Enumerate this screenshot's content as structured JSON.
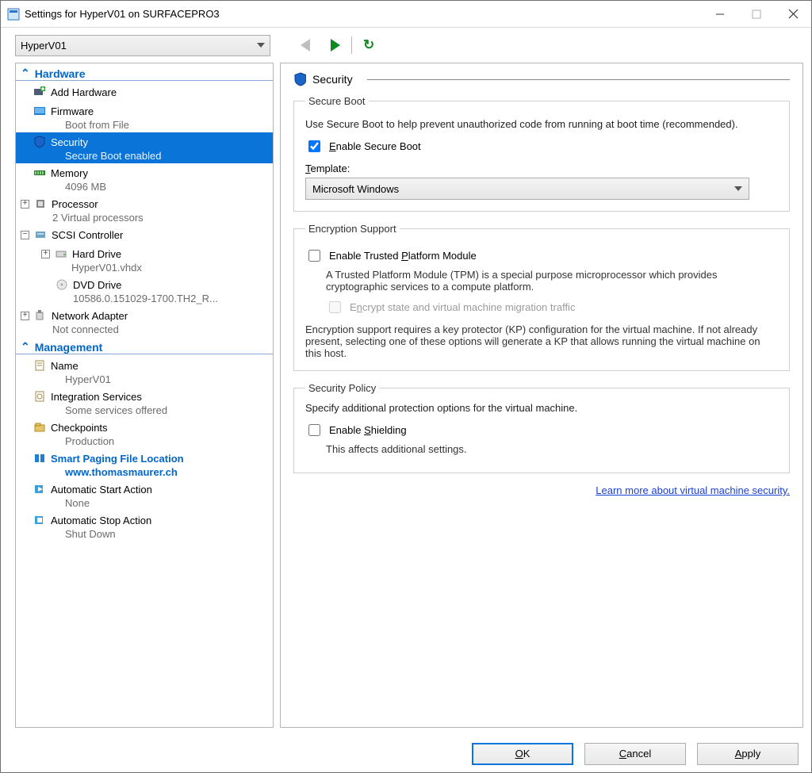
{
  "window": {
    "title": "Settings for HyperV01 on SURFACEPRO3"
  },
  "toolbar": {
    "vm_name": "HyperV01"
  },
  "tree": {
    "hardware_hdr": "Hardware",
    "management_hdr": "Management",
    "add_hw": "Add Hardware",
    "firmware": {
      "label": "Firmware",
      "sub": "Boot from File"
    },
    "security": {
      "label": "Security",
      "sub": "Secure Boot enabled"
    },
    "memory": {
      "label": "Memory",
      "sub": "4096 MB"
    },
    "processor": {
      "label": "Processor",
      "sub": "2 Virtual processors"
    },
    "scsi": {
      "label": "SCSI Controller"
    },
    "hdd": {
      "label": "Hard Drive",
      "sub": "HyperV01.vhdx"
    },
    "dvd": {
      "label": "DVD Drive",
      "sub": "10586.0.151029-1700.TH2_R..."
    },
    "nic": {
      "label": "Network Adapter",
      "sub": "Not connected"
    },
    "name": {
      "label": "Name",
      "sub": "HyperV01"
    },
    "integ": {
      "label": "Integration Services",
      "sub": "Some services offered"
    },
    "checkpoints": {
      "label": "Checkpoints",
      "sub": "Production"
    },
    "paging": {
      "label": "Smart Paging File Location",
      "sub": "www.thomasmaurer.ch"
    },
    "autostart": {
      "label": "Automatic Start Action",
      "sub": "None"
    },
    "autostop": {
      "label": "Automatic Stop Action",
      "sub": "Shut Down"
    }
  },
  "detail": {
    "title": "Security",
    "secureboot": {
      "legend": "Secure Boot",
      "desc": "Use Secure Boot to help prevent unauthorized code from running at boot time (recommended).",
      "enable_label": "Enable Secure Boot",
      "template_label": "Template:",
      "template_value": "Microsoft Windows"
    },
    "encryption": {
      "legend": "Encryption Support",
      "enable_tpm": "Enable Trusted Platform Module",
      "tpm_desc": "A Trusted Platform Module (TPM) is a special purpose microprocessor which provides cryptographic services to a compute platform.",
      "encrypt_state": "Encrypt state and virtual machine migration traffic",
      "kp_note": "Encryption support requires a key protector (KP) configuration for the virtual machine. If not already present, selecting one of these options will generate a KP that allows running the virtual machine on this host."
    },
    "policy": {
      "legend": "Security Policy",
      "desc": "Specify additional protection options for the virtual machine.",
      "shielding": "Enable Shielding",
      "note": "This affects additional settings."
    },
    "learn_more": "Learn more about virtual machine security."
  },
  "buttons": {
    "ok": "OK",
    "cancel": "Cancel",
    "apply": "Apply"
  }
}
